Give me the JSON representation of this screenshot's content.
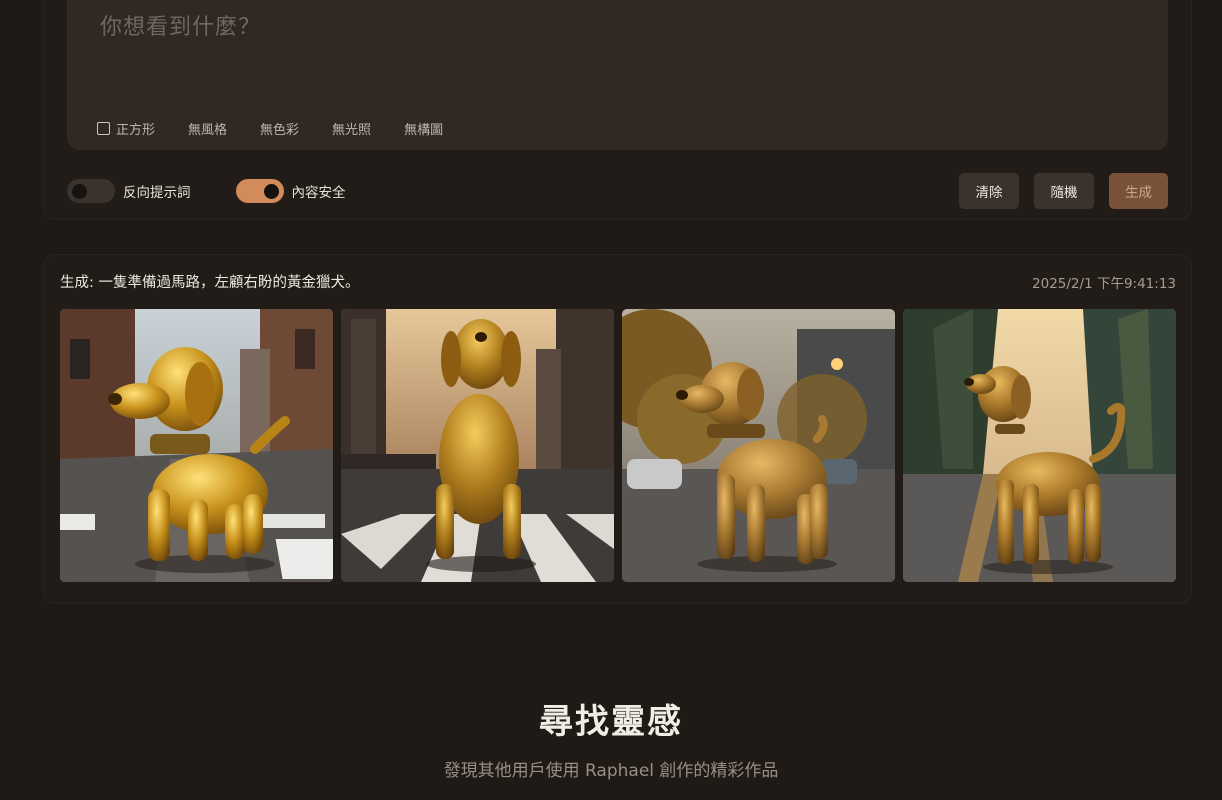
{
  "prompt": {
    "placeholder": "你想看到什麼？",
    "chips": [
      "正方形",
      "無風格",
      "無色彩",
      "無光照",
      "無構圖"
    ]
  },
  "toggles": [
    {
      "label": "反向提示詞",
      "on": false
    },
    {
      "label": "內容安全",
      "on": true
    }
  ],
  "buttons": {
    "clear": "清除",
    "random": "隨機",
    "generate": "生成"
  },
  "result": {
    "title": "生成: 一隻準備過馬路，左顧右盼的黃金獵犬。",
    "timestamp": "2025/2/1 下午9:41:13"
  },
  "inspiration": {
    "title": "尋找靈感",
    "subtitle": "發現其他用戶使用 Raphael 創作的精彩作品"
  },
  "colors": {
    "background": "#1f1a16",
    "panel": "#221c18",
    "accent": "#d18c5a",
    "generate_button": "#7a5237"
  }
}
